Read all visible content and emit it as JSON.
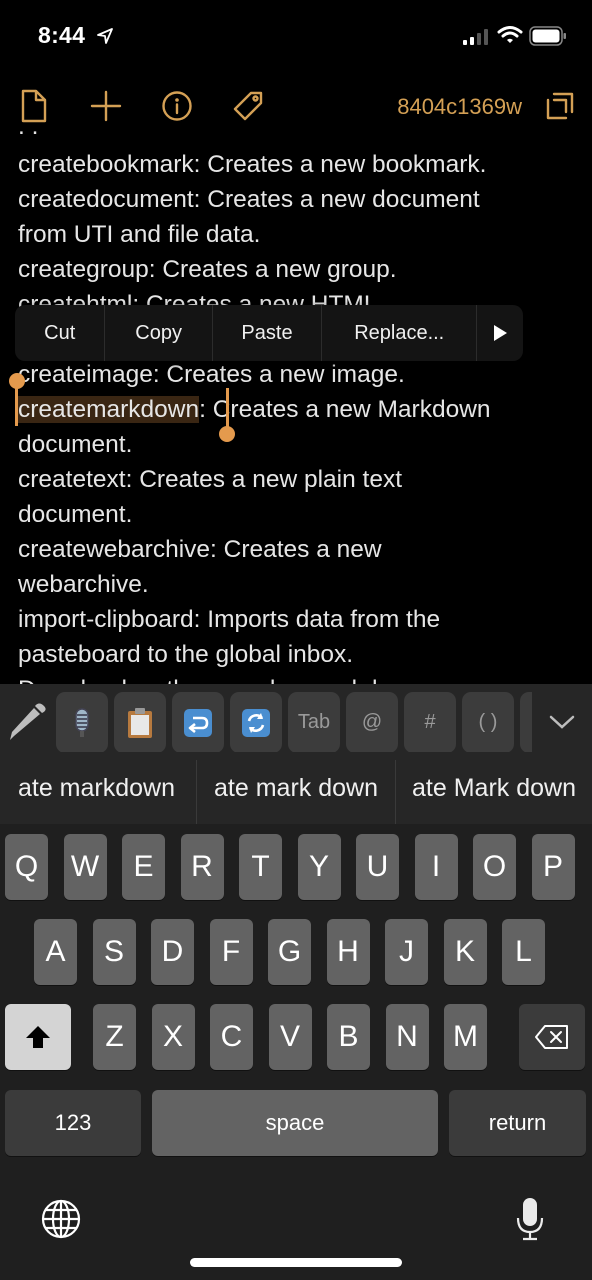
{
  "status_bar": {
    "time": "8:44",
    "icons": [
      "location-arrow-icon",
      "cellular-signal-icon",
      "wifi-icon",
      "battery-icon"
    ]
  },
  "toolbar": {
    "icons": [
      "document-icon",
      "plus-icon",
      "info-icon",
      "tag-icon",
      "duplicate-icon"
    ],
    "document_title": "8404c1369w"
  },
  "colors": {
    "accent": "#d4a055",
    "selection_handle": "#e49a4d",
    "background": "#000000",
    "key": "#636363"
  },
  "editor": {
    "lines": [
      "createbookmark:  Creates a new bookmark.",
      "createdocument:  Creates a new document",
      "from UTI and file data.",
      "creategroup:  Creates a new group.",
      "createhtml:  Creates a new HTML",
      "createimage:  Creates a new image.",
      ":  Creates a new Markdown",
      "document.",
      "createtext:  Creates a new plain text",
      "document.",
      "createwebarchive:  Creates a new",
      "webarchive.",
      "import-clipboard:  Imports data from the",
      "pasteboard to the global inbox.",
      "Downloads a the ... and ... markdown"
    ],
    "selected_text": "createmarkdown"
  },
  "context_menu": {
    "items": [
      "Cut",
      "Copy",
      "Paste",
      "Replace..."
    ],
    "more_icon": "triangle-right-icon"
  },
  "keyboard": {
    "accessory_keys": [
      "pencil-icon",
      "microphone-emoji-icon",
      "clipboard-emoji-icon",
      "return-arrow-emoji-icon",
      "refresh-emoji-icon",
      "Tab",
      "@",
      "#",
      "( )"
    ],
    "dismiss_icon": "chevron-down-icon",
    "suggestions": [
      "ate markdown",
      "ate mark down",
      "ate Mark down"
    ],
    "row1": [
      "Q",
      "W",
      "E",
      "R",
      "T",
      "Y",
      "U",
      "I",
      "O",
      "P"
    ],
    "row2": [
      "A",
      "S",
      "D",
      "F",
      "G",
      "H",
      "J",
      "K",
      "L"
    ],
    "row3": [
      "Z",
      "X",
      "C",
      "V",
      "B",
      "N",
      "M"
    ],
    "numbers_label": "123",
    "space_label": "space",
    "return_label": "return"
  }
}
